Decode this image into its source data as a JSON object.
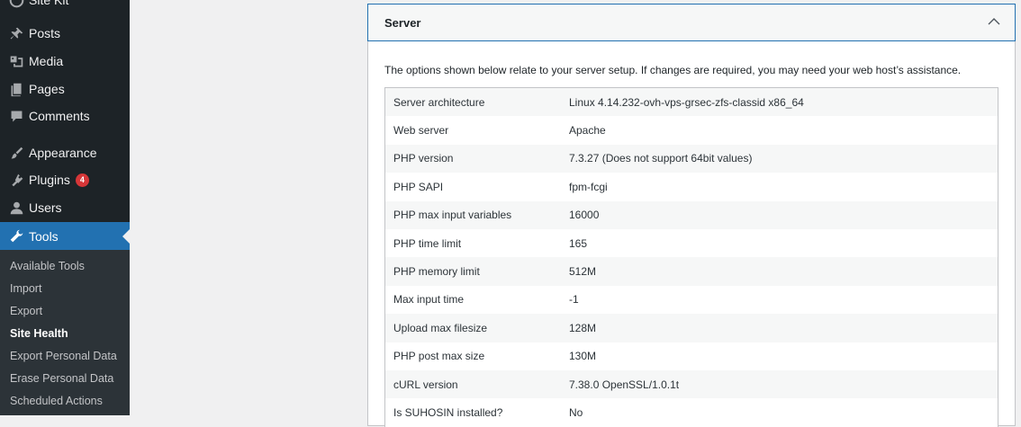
{
  "sidebar": {
    "items": [
      {
        "label": "Site Kit",
        "icon": "site-kit-icon"
      },
      {
        "label": "Posts",
        "icon": "pin-icon"
      },
      {
        "label": "Media",
        "icon": "media-icon"
      },
      {
        "label": "Pages",
        "icon": "pages-icon"
      },
      {
        "label": "Comments",
        "icon": "comment-icon"
      },
      {
        "label": "Appearance",
        "icon": "paintbrush-icon"
      },
      {
        "label": "Plugins",
        "icon": "plugin-icon",
        "badge": "4"
      },
      {
        "label": "Users",
        "icon": "user-icon"
      },
      {
        "label": "Tools",
        "icon": "wrench-icon",
        "active": true
      }
    ],
    "submenu": [
      {
        "label": "Available Tools"
      },
      {
        "label": "Import"
      },
      {
        "label": "Export"
      },
      {
        "label": "Site Health",
        "current": true
      },
      {
        "label": "Export Personal Data"
      },
      {
        "label": "Erase Personal Data"
      },
      {
        "label": "Scheduled Actions"
      }
    ]
  },
  "panel": {
    "title": "Server",
    "intro": "The options shown below relate to your server setup. If changes are required, you may need your web host’s assistance.",
    "rows": [
      {
        "label": "Server architecture",
        "value": "Linux 4.14.232-ovh-vps-grsec-zfs-classid x86_64"
      },
      {
        "label": "Web server",
        "value": "Apache"
      },
      {
        "label": "PHP version",
        "value": "7.3.27 (Does not support 64bit values)"
      },
      {
        "label": "PHP SAPI",
        "value": "fpm-fcgi"
      },
      {
        "label": "PHP max input variables",
        "value": "16000"
      },
      {
        "label": "PHP time limit",
        "value": "165"
      },
      {
        "label": "PHP memory limit",
        "value": "512M"
      },
      {
        "label": "Max input time",
        "value": "-1"
      },
      {
        "label": "Upload max filesize",
        "value": "128M"
      },
      {
        "label": "PHP post max size",
        "value": "130M"
      },
      {
        "label": "cURL version",
        "value": "7.38.0 OpenSSL/1.0.1t"
      },
      {
        "label": "Is SUHOSIN installed?",
        "value": "No"
      }
    ]
  },
  "colors": {
    "sidebar_bg": "#1d2327",
    "submenu_bg": "#2c3338",
    "accent": "#2271b1",
    "badge": "#d63638"
  }
}
